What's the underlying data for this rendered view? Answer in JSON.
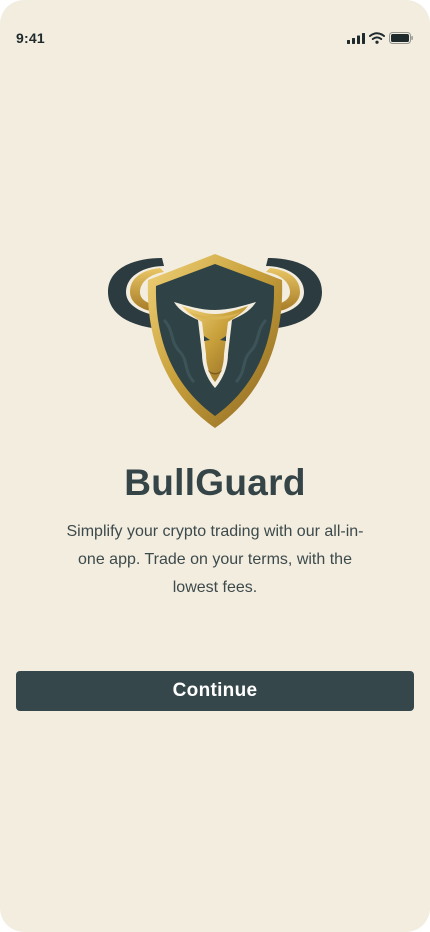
{
  "status_bar": {
    "time": "9:41",
    "icons": [
      "cellular-signal-icon",
      "wifi-icon",
      "battery-icon"
    ]
  },
  "brand": {
    "logo": "bull-shield-logo",
    "title": "BullGuard",
    "tagline": "Simplify your crypto trading with our all-in-one app. Trade on your terms, with the lowest fees."
  },
  "actions": {
    "continue_label": "Continue"
  },
  "colors": {
    "background": "#f3ede0",
    "primary": "#35474a",
    "accent_gold": "#c9a13c",
    "text": "#354547"
  }
}
